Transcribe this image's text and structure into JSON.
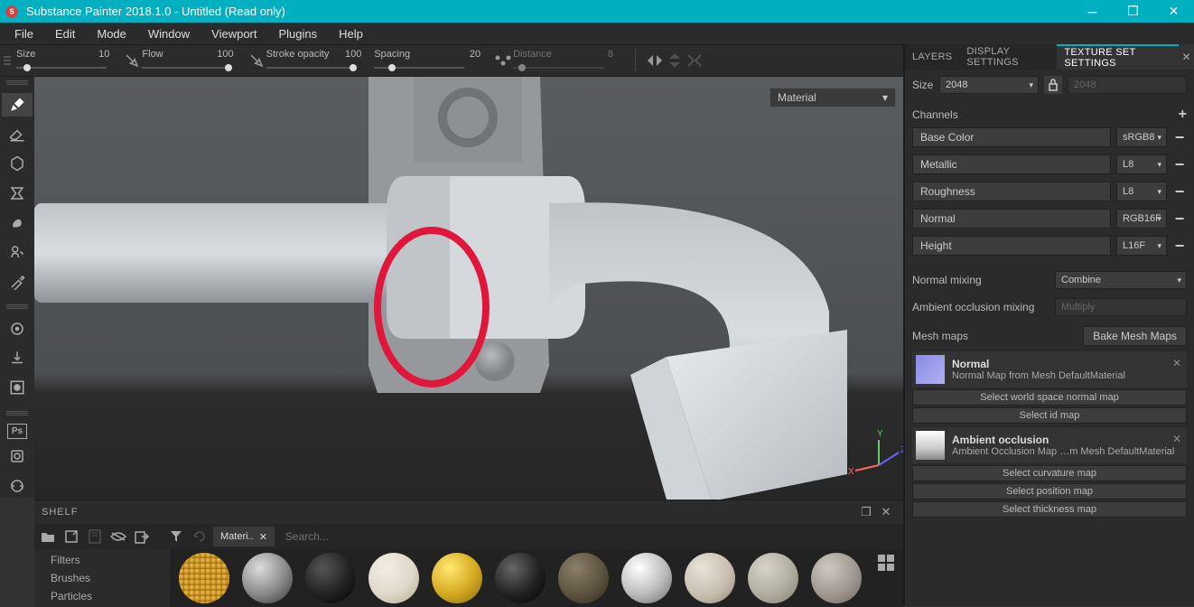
{
  "title": "Substance Painter 2018.1.0 - Untitled (Read only)",
  "menu": [
    "File",
    "Edit",
    "Mode",
    "Window",
    "Viewport",
    "Plugins",
    "Help"
  ],
  "topbar": {
    "size": {
      "label": "Size",
      "value": "10"
    },
    "flow": {
      "label": "Flow",
      "value": "100"
    },
    "stroke": {
      "label": "Stroke opacity",
      "value": "100"
    },
    "spacing": {
      "label": "Spacing",
      "value": "20"
    },
    "distance": {
      "label": "Distance",
      "value": "8"
    }
  },
  "viewport": {
    "mode": "Material"
  },
  "rightTabs": {
    "layers": "LAYERS",
    "display": "DISPLAY SETTINGS",
    "texset": "TEXTURE SET SETTINGS"
  },
  "texset": {
    "sizeLabel": "Size",
    "sizeValue": "2048",
    "sizeLocked": "2048",
    "channelsLabel": "Channels",
    "channels": [
      {
        "name": "Base Color",
        "fmt": "sRGB8"
      },
      {
        "name": "Metallic",
        "fmt": "L8"
      },
      {
        "name": "Roughness",
        "fmt": "L8"
      },
      {
        "name": "Normal",
        "fmt": "RGB16F"
      },
      {
        "name": "Height",
        "fmt": "L16F"
      }
    ],
    "normalMixLabel": "Normal mixing",
    "normalMixValue": "Combine",
    "aoMixLabel": "Ambient occlusion mixing",
    "aoMixValue": "Multiply",
    "meshMapsLabel": "Mesh maps",
    "bakeBtn": "Bake Mesh Maps",
    "maps": {
      "normal": {
        "title": "Normal",
        "sub": "Normal Map from Mesh DefaultMaterial"
      },
      "worldNormal": "Select world space normal map",
      "id": "Select id map",
      "ao": {
        "title": "Ambient occlusion",
        "sub": "Ambient Occlusion Map …m Mesh DefaultMaterial"
      },
      "curvature": "Select curvature map",
      "position": "Select position map",
      "thickness": "Select thickness map"
    }
  },
  "shelf": {
    "title": "SHELF",
    "tab": "Materi..",
    "searchPlaceholder": "Search...",
    "categories": [
      "Filters",
      "Brushes",
      "Particles"
    ]
  }
}
